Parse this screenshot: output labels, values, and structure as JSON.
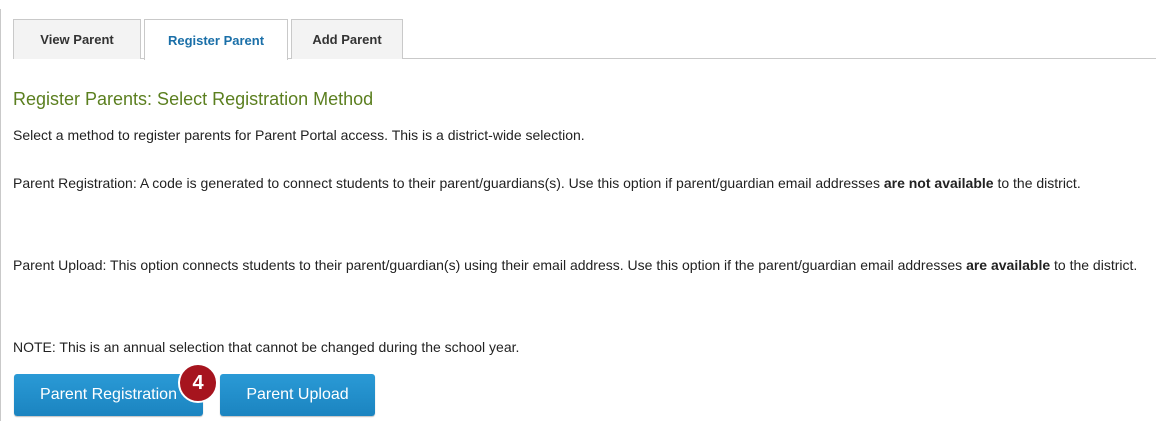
{
  "tabs": [
    {
      "label": "View Parent",
      "active": false
    },
    {
      "label": "Register Parent",
      "active": true
    },
    {
      "label": "Add Parent",
      "active": false
    }
  ],
  "main": {
    "heading": "Register Parents: Select Registration Method",
    "intro": "Select a method to register parents for Parent Portal access. This is a district-wide selection.",
    "registration_text_1": "Parent Registration: A code is generated to connect students to their parent/guardians(s). Use this option if parent/guardian email addresses ",
    "registration_bold": "are not available",
    "registration_text_2": " to the district.",
    "upload_text_1": "Parent Upload: This option connects students to their parent/guardian(s) using their email address. Use this option if the parent/guardian email addresses ",
    "upload_bold": "are available",
    "upload_text_2": " to the district.",
    "note": "NOTE: This is an annual selection that cannot be changed during the school year."
  },
  "buttons": {
    "registration_label": "Parent Registration",
    "upload_label": "Parent Upload"
  },
  "annotation": {
    "step_number": "4"
  },
  "colors": {
    "heading": "#5b7f1f",
    "active_tab_text": "#1a6fa8",
    "button": "#1b84c0",
    "badge": "#a6141e"
  }
}
